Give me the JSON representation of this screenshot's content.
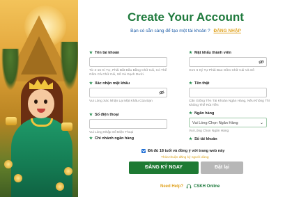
{
  "header": {
    "title": "Create Your Account",
    "subtitle": "Bạn có sẵn sàng để tạo một tài khoản ?",
    "login_link": "ĐĂNG NHẬP"
  },
  "fields": {
    "username": {
      "label": "Tên tài khoản",
      "hint": "Từ 2-15 Kí Tự, Phải Bắt Đầu Bằng Chữ Cái, Có Thể Gồm Cả Chữ Cái, Số Và Gạch Dưới.",
      "value": ""
    },
    "password": {
      "label": "Mật khẩu thành viên",
      "hint": "Hơn 6 Ký Tự Phải Bao Gồm Chữ Cái Và Số",
      "value": ""
    },
    "confirm_password": {
      "label": "Xác nhận mật khẩu",
      "hint": "Vui Lòng Xác Nhận Lại Mật Khẩu Của Bạn",
      "value": ""
    },
    "real_name": {
      "label": "Tên thật",
      "hint": "Cần Giống Tên Tài Khoản Ngân Hàng, Nếu Không Thì Không Thể Rút Tiền",
      "value": ""
    },
    "phone": {
      "label": "Số điện thoại",
      "hint": "Vui Lòng Nhập Số Điện Thoại",
      "value": ""
    },
    "bank": {
      "label": "Ngân hàng",
      "selected": "Vui Lòng Chọn Ngân Hàng",
      "hint": "Vui Lòng Chọn Ngân Hàng"
    },
    "bank_branch": {
      "label": "Chi nhánh ngân hàng"
    },
    "account_number": {
      "label": "Số tài khoản"
    }
  },
  "agreement": {
    "text": "Đã đủ 18 tuổi và đồng ý với trang web này",
    "terms": "Thỏa thuận đăng ký người dùng",
    "checked": true
  },
  "buttons": {
    "register": "ĐĂNG KÝ NGAY",
    "reset": "Đặt lại"
  },
  "help": {
    "need_help": "Need Help?",
    "support": "CSKH Online",
    "icon": "headset-icon"
  },
  "colors": {
    "brand_green": "#1f7a3d",
    "accent_gold": "#e0a321",
    "link_blue": "#1f5ea8"
  }
}
